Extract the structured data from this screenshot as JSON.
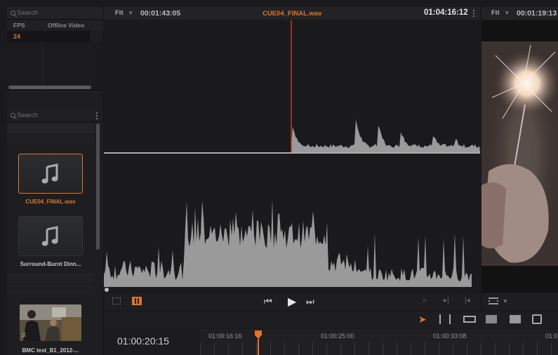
{
  "media_pool": {
    "search_placeholder": "Search",
    "columns": [
      "FPS",
      "Offline Video"
    ],
    "row_value": "24",
    "bin_search_placeholder": "Search",
    "clips": [
      {
        "name": "CUE04_FINAL.wav",
        "icon": "music-note-icon",
        "selected": true
      },
      {
        "name": "Surround-Burnt Dinn...",
        "icon": "music-note-icon",
        "selected": false
      },
      {
        "name": "BMC test_B1_2012-...",
        "icon": "video-thumbnail",
        "selected": false
      }
    ]
  },
  "source_viewer": {
    "zoom": "Fit",
    "timecode_left": "00:01:43:05",
    "clip_name": "CUE04_FINAL.wav",
    "timecode_right": "01:04:16:12"
  },
  "record_viewer": {
    "zoom": "Fit",
    "timecode": "00:01:19:13"
  },
  "timeline": {
    "current_timecode": "01:00:20:15",
    "ruler_labels": [
      "01:00:16:16",
      "01:00:25:00",
      "01:00:33:08",
      "01:0"
    ]
  },
  "colors": {
    "accent": "#e2732a",
    "playhead": "#c0392b",
    "waveform": "#9a9a9a",
    "background": "#1a1a1c"
  }
}
